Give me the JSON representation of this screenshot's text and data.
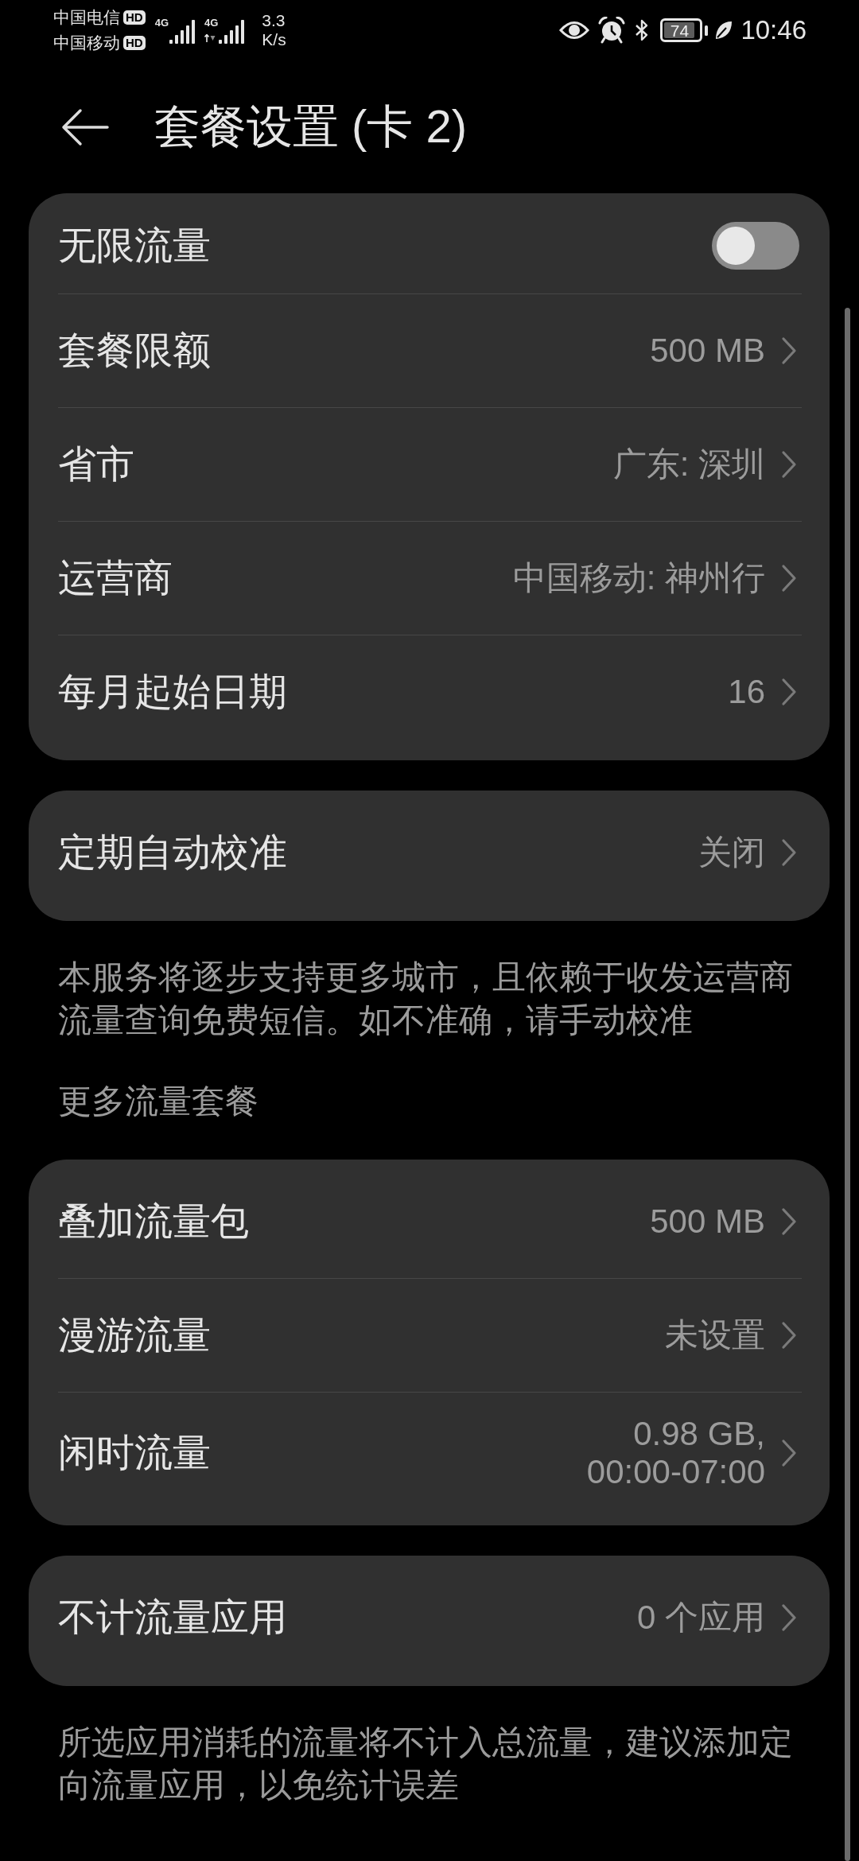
{
  "status_bar": {
    "carriers": [
      {
        "name": "中国电信",
        "badge": "HD"
      },
      {
        "name": "中国移动",
        "badge": "HD"
      }
    ],
    "signals": [
      {
        "network": "4G",
        "activity": false
      },
      {
        "network": "4G",
        "activity": true
      }
    ],
    "speed": {
      "value": "3.3",
      "unit": "K/s"
    },
    "battery": {
      "percent": "74"
    },
    "time": "10:46"
  },
  "header": {
    "title": "套餐设置 (卡 2)"
  },
  "sections": [
    {
      "kind": "card",
      "rows": [
        {
          "kind": "toggle",
          "label": "无限流量",
          "on": false
        },
        {
          "kind": "link",
          "label": "套餐限额",
          "value": "500 MB"
        },
        {
          "kind": "link",
          "label": "省市",
          "value": "广东: 深圳"
        },
        {
          "kind": "link",
          "label": "运营商",
          "value": "中国移动: 神州行"
        },
        {
          "kind": "link",
          "label": "每月起始日期",
          "value": "16"
        }
      ]
    },
    {
      "kind": "card",
      "rows": [
        {
          "kind": "link",
          "label": "定期自动校准",
          "value": "关闭"
        }
      ]
    },
    {
      "kind": "note",
      "text": "本服务将逐步支持更多城市，且依赖于收发运营商流量查询免费短信。如不准确，请手动校准"
    },
    {
      "kind": "subheading",
      "text": "更多流量套餐"
    },
    {
      "kind": "card",
      "rows": [
        {
          "kind": "link",
          "label": "叠加流量包",
          "value": "500 MB"
        },
        {
          "kind": "link",
          "label": "漫游流量",
          "value": "未设置"
        },
        {
          "kind": "link",
          "label": "闲时流量",
          "value": "0.98 GB,\n00:00-07:00"
        }
      ]
    },
    {
      "kind": "card",
      "rows": [
        {
          "kind": "link",
          "label": "不计流量应用",
          "value": "0 个应用"
        }
      ]
    },
    {
      "kind": "note",
      "text": "所选应用消耗的流量将不计入总流量，建议添加定向流量应用，以免统计误差"
    }
  ]
}
